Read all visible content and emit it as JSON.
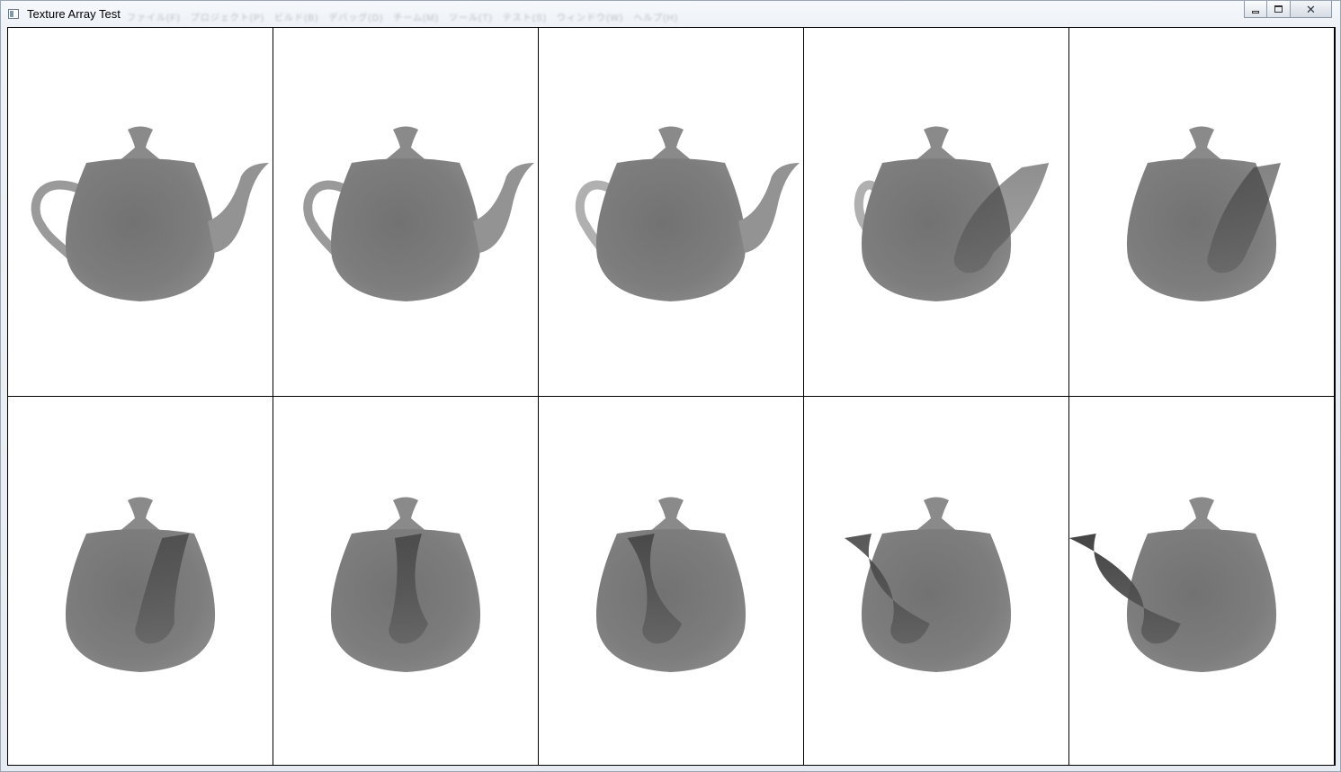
{
  "window": {
    "title": "Texture Array Test",
    "background_menu_ghost": "ファイル(F)　プロジェクト(P)　ビルド(B)　デバッグ(D)　チーム(M)　ツール(T)　テスト(S)　ウィンドウ(W)　ヘルプ(H)",
    "controls": {
      "minimize": "",
      "maximize": "",
      "close": "✕"
    }
  },
  "viewport": {
    "rows": 2,
    "columns": 5,
    "clear_color": "#ffffff",
    "separator_color": "#000000",
    "render_mode": "depth-grayscale",
    "object": "teapot",
    "panels": [
      {
        "index": 0,
        "yaw_deg": 0
      },
      {
        "index": 1,
        "yaw_deg": 10
      },
      {
        "index": 2,
        "yaw_deg": 20
      },
      {
        "index": 3,
        "yaw_deg": 40
      },
      {
        "index": 4,
        "yaw_deg": 60
      },
      {
        "index": 5,
        "yaw_deg": 75
      },
      {
        "index": 6,
        "yaw_deg": 90
      },
      {
        "index": 7,
        "yaw_deg": 105
      },
      {
        "index": 8,
        "yaw_deg": 130
      },
      {
        "index": 9,
        "yaw_deg": 165
      }
    ]
  }
}
